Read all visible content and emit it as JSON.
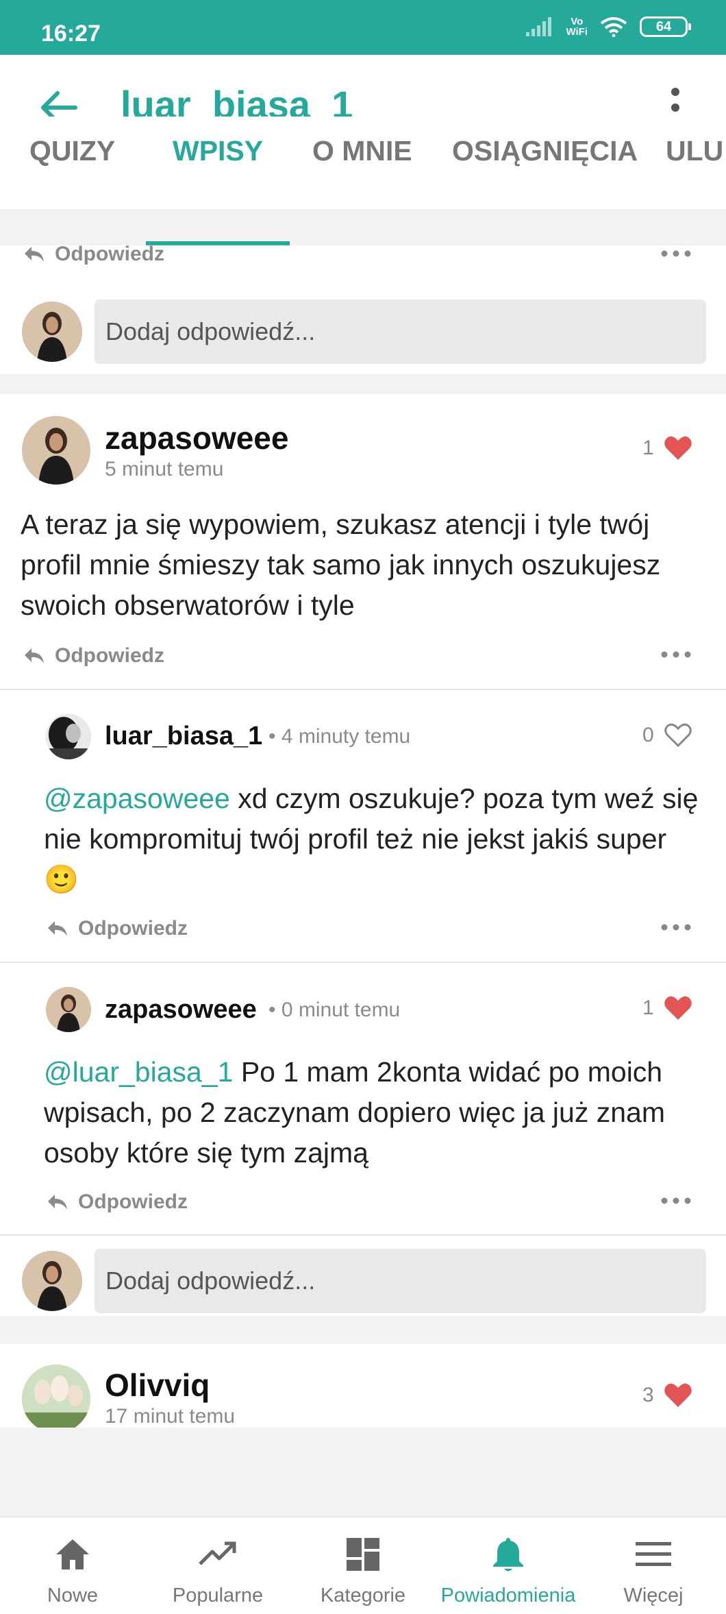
{
  "status": {
    "time": "16:27",
    "vowifi_top": "Vo",
    "vowifi_bottom": "WiFi",
    "battery": "64"
  },
  "header": {
    "title": "luar_biasa_1"
  },
  "tabs": [
    {
      "label": "QUIZY",
      "active": false
    },
    {
      "label": "WPISY",
      "active": true
    },
    {
      "label": "O MNIE",
      "active": false
    },
    {
      "label": "OSIĄGNIĘCIA",
      "active": false
    },
    {
      "label": "ULU",
      "active": false
    }
  ],
  "actions": {
    "reply_label": "Odpowiedz",
    "reply_placeholder": "Dodaj odpowiedź..."
  },
  "posts": [
    {
      "author": "zapasoweee",
      "time": "5 minut temu",
      "likes": "1",
      "liked": true,
      "text": "A teraz ja się wypowiem, szukasz atencji i tyle twój profil mnie śmieszy tak samo jak innych oszukujesz swoich obserwatorów i tyle",
      "replies": [
        {
          "author": "luar_biasa_1",
          "time": "• 4 minuty temu",
          "likes": "0",
          "liked": false,
          "mention": "@zapasoweee",
          "text": " xd czym oszukuje? poza tym weź się nie kompromituj twój profil też nie jekst jakiś super🙂"
        },
        {
          "author": "zapasoweee",
          "time": "• 0 minut temu",
          "likes": "1",
          "liked": true,
          "mention": "@luar_biasa_1",
          "text": " Po 1 mam 2konta widać po moich wpisach, po 2 zaczynam dopiero więc ja już znam osoby które się tym zajmą"
        }
      ]
    },
    {
      "author": "Olivviq",
      "time": "17 minut temu",
      "likes": "3",
      "liked": true
    }
  ],
  "nav": [
    {
      "label": "Nowe",
      "icon": "home-icon",
      "active": false
    },
    {
      "label": "Popularne",
      "icon": "trending-icon",
      "active": false
    },
    {
      "label": "Kategorie",
      "icon": "grid-icon",
      "active": false
    },
    {
      "label": "Powiadomienia",
      "icon": "bell-icon",
      "active": true
    },
    {
      "label": "Więcej",
      "icon": "menu-icon",
      "active": false
    }
  ],
  "colors": {
    "accent": "#25a99a",
    "like": "#e35555",
    "muted": "#8a8a8a"
  }
}
